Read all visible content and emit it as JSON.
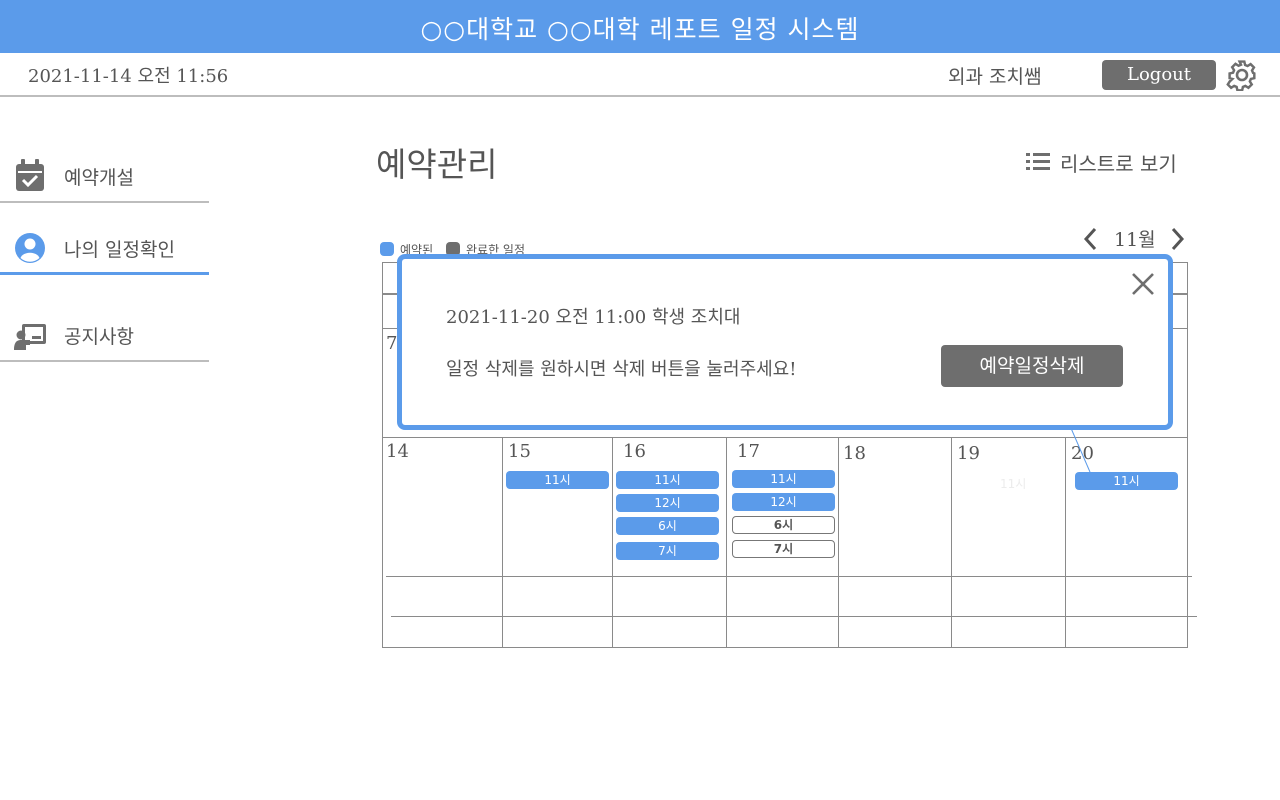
{
  "header": {
    "title": "○○대학교 ○○대학 레포트 일정 시스템"
  },
  "subbar": {
    "datetime": "2021-11-14 오전 11:56",
    "username": "외과 조치쌤",
    "logout_label": "Logout",
    "settings_icon": "gear-icon"
  },
  "sidebar": {
    "items": [
      {
        "label": "예약개설",
        "icon": "calendar-check-icon",
        "active": false
      },
      {
        "label": "나의 일정확인",
        "icon": "user-circle-icon",
        "active": true
      },
      {
        "label": "공지사항",
        "icon": "presentation-icon",
        "active": false
      }
    ]
  },
  "main": {
    "title": "예약관리",
    "list_view_label": "리스트로 보기",
    "legend": [
      {
        "label": "예약된",
        "color": "#5b9bea"
      },
      {
        "label": "완료한 일정",
        "color": "#6e6e6e"
      }
    ],
    "month": "11월"
  },
  "calendar": {
    "week_prev_first_day": "7",
    "days": [
      "14",
      "15",
      "16",
      "17",
      "18",
      "19",
      "20"
    ],
    "slots": {
      "day15": [
        "11시"
      ],
      "day16": [
        "11시",
        "12시",
        "6시",
        "7시"
      ],
      "day17_booked": [
        "11시",
        "12시"
      ],
      "day17_open": [
        "6시",
        "7시"
      ],
      "day19_faded": "11시",
      "day20": [
        "11시"
      ]
    }
  },
  "modal": {
    "info": "2021-11-20 오전 11:00 학생 조치대",
    "message": "일정 삭제를 원하시면 삭제 버튼을 눌러주세요!",
    "delete_label": "예약일정삭제"
  },
  "colors": {
    "accent": "#5b9bea",
    "button_gray": "#6e6e6e",
    "text": "#555555"
  }
}
